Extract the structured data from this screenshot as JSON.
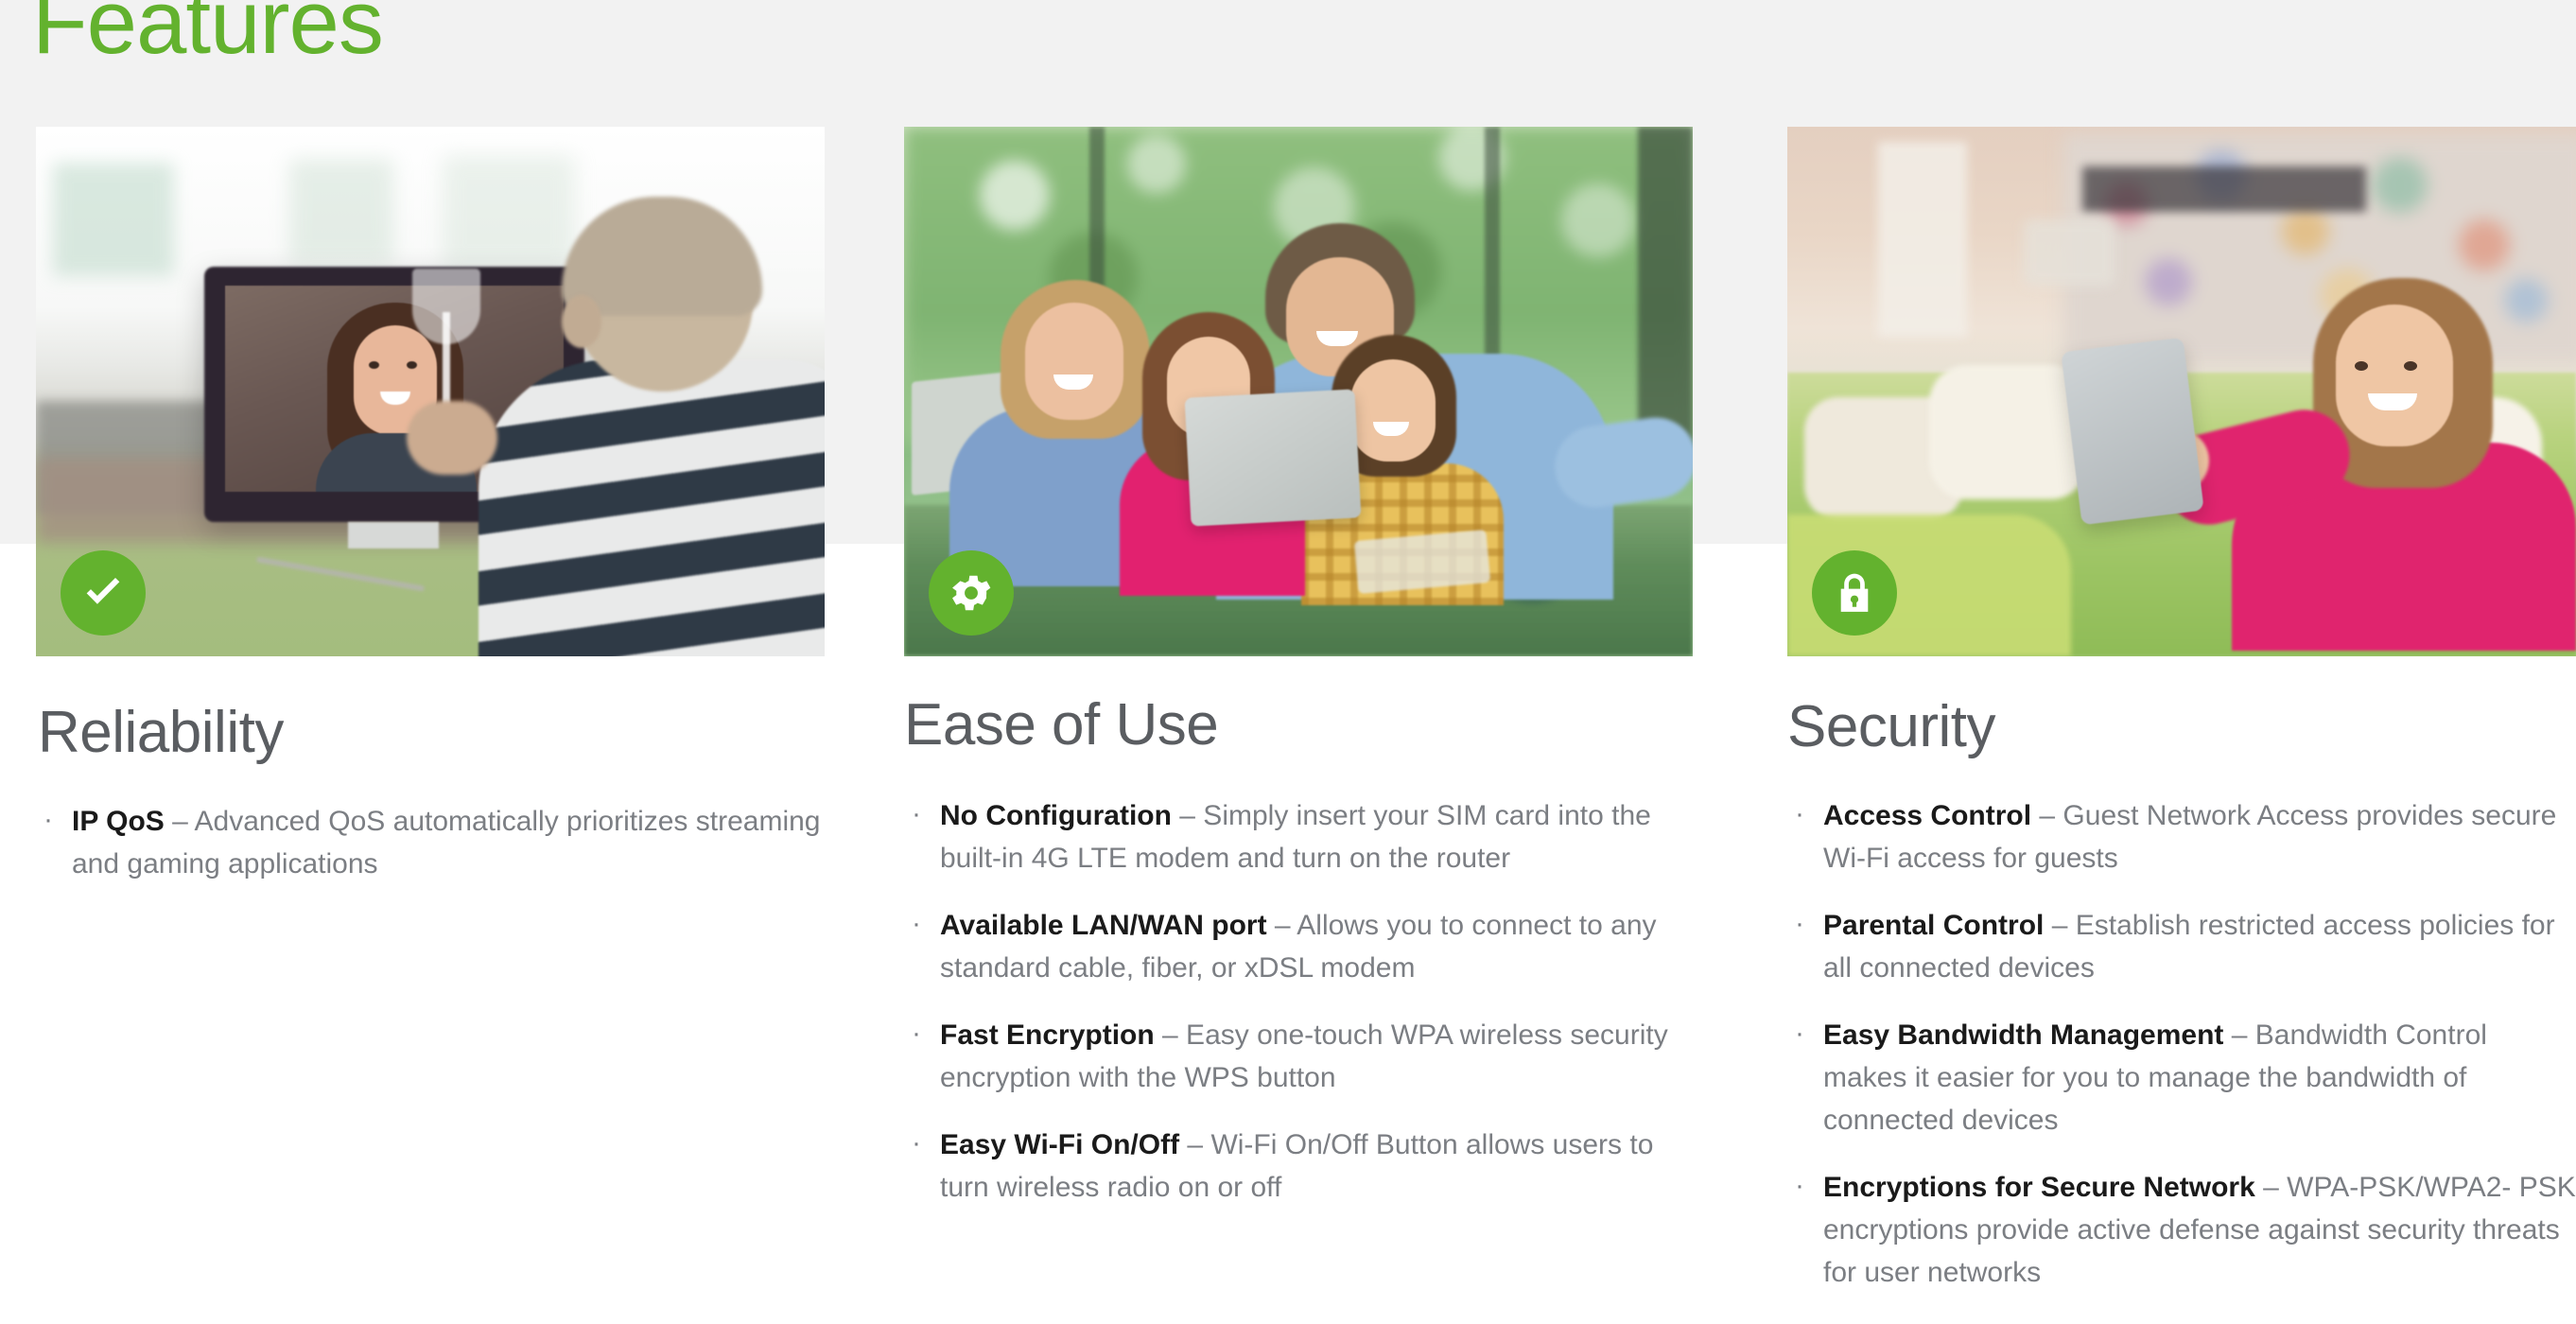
{
  "slide": {
    "title": "Features",
    "accent_green": "#63b22e",
    "heading_gray": "#5a5d61",
    "body_gray": "#7b7e83",
    "lead_black": "#1a1a1a",
    "band_gray": "#f2f2f2",
    "background": "#ffffff"
  },
  "columns": [
    {
      "id": "reliability",
      "heading": "Reliability",
      "icon": "check-icon",
      "photo_alt": "man holding a glass toasting a woman on a video call monitor",
      "bullets": [
        {
          "lead": "IP QoS",
          "rest": " – Advanced QoS automatically prioritizes streaming and gaming applications"
        }
      ]
    },
    {
      "id": "ease-of-use",
      "heading": "Ease of Use",
      "icon": "gear-icon",
      "photo_alt": "family of four looking at a tablet together at a table",
      "bullets": [
        {
          "lead": "No Configuration",
          "rest": " – Simply insert your SIM card into the built-in 4G LTE modem and turn on the router"
        },
        {
          "lead": "Available LAN/WAN port",
          "rest": " – Allows you to connect to any standard cable, fiber, or xDSL modem"
        },
        {
          "lead": "Fast Encryption",
          "rest": " – Easy one-touch WPA wireless security encryption with the WPS button"
        },
        {
          "lead": "Easy Wi-Fi On/Off",
          "rest": " – Wi-Fi On/Off Button allows users to turn wireless radio on or off"
        }
      ]
    },
    {
      "id": "security",
      "heading": "Security",
      "icon": "lock-icon",
      "photo_alt": "woman lying on a green sofa holding a tablet",
      "bullets": [
        {
          "lead": "Access Control",
          "rest": " – Guest Network Access provides secure Wi-Fi access for guests"
        },
        {
          "lead": "Parental Control",
          "rest": " – Establish restricted access policies for all connected devices"
        },
        {
          "lead": "Easy Bandwidth Management",
          "rest": " – Bandwidth Control makes it easier for you to manage the bandwidth of connected devices"
        },
        {
          "lead": " Encryptions for Secure Network",
          "rest": " – WPA-PSK/WPA2- PSK encryptions provide active defense against security threats for user networks"
        }
      ]
    }
  ]
}
